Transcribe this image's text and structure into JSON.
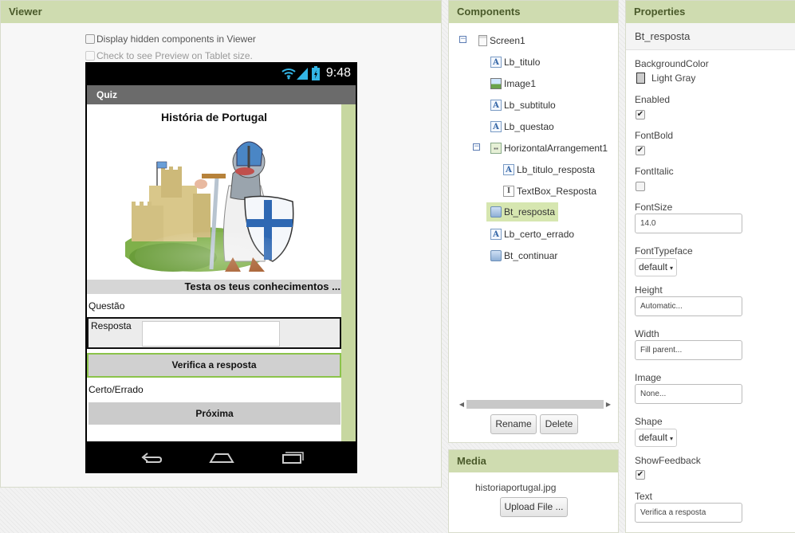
{
  "viewer": {
    "header": "Viewer",
    "display_hidden_label": "Display hidden components in Viewer",
    "tablet_preview_label": "Check to see Preview on Tablet size.",
    "phone": {
      "time": "9:48",
      "app_title": "Quiz",
      "lb_titulo": "História de Portugal",
      "lb_subtitulo": "Testa os teus conhecimentos ...",
      "lb_questao": "Questão",
      "lb_titulo_resposta": "Resposta",
      "textbox_value": "",
      "bt_resposta": "Verifica a resposta",
      "lb_certo_errado": "Certo/Errado",
      "bt_continuar": "Próxima"
    }
  },
  "components": {
    "header": "Components",
    "tree": [
      {
        "label": "Screen1",
        "icon": "screen-icon"
      },
      {
        "label": "Lb_titulo",
        "icon": "label-icon"
      },
      {
        "label": "Image1",
        "icon": "image-icon"
      },
      {
        "label": "Lb_subtitulo",
        "icon": "label-icon"
      },
      {
        "label": "Lb_questao",
        "icon": "label-icon"
      },
      {
        "label": "HorizontalArrangement1",
        "icon": "horizontal-arrangement-icon"
      },
      {
        "label": "Lb_titulo_resposta",
        "icon": "label-icon"
      },
      {
        "label": "TextBox_Resposta",
        "icon": "textbox-icon"
      },
      {
        "label": "Bt_resposta",
        "icon": "button-icon",
        "selected": true
      },
      {
        "label": "Lb_certo_errado",
        "icon": "label-icon"
      },
      {
        "label": "Bt_continuar",
        "icon": "button-icon"
      }
    ],
    "rename_label": "Rename",
    "delete_label": "Delete"
  },
  "media": {
    "header": "Media",
    "file": "historiaportugal.jpg",
    "upload_label": "Upload File ..."
  },
  "properties": {
    "header": "Properties",
    "selected_component": "Bt_resposta",
    "background_color_label": "BackgroundColor",
    "background_color_value": "Light Gray",
    "enabled_label": "Enabled",
    "enabled": true,
    "fontbold_label": "FontBold",
    "fontbold": true,
    "fontitalic_label": "FontItalic",
    "fontitalic": false,
    "fontsize_label": "FontSize",
    "fontsize_value": "14.0",
    "fonttypeface_label": "FontTypeface",
    "fonttypeface_value": "default",
    "height_label": "Height",
    "height_value": "Automatic...",
    "width_label": "Width",
    "width_value": "Fill parent...",
    "image_label": "Image",
    "image_value": "None...",
    "shape_label": "Shape",
    "shape_value": "default",
    "showfeedback_label": "ShowFeedback",
    "showfeedback": true,
    "text_label": "Text",
    "text_value": "Verifica a resposta"
  },
  "colors": {
    "panel_header": "#cfdcb0",
    "selected_item": "#d6e6b0",
    "button_border_highlight": "#8bc34a",
    "light_gray": "#cccccc"
  }
}
